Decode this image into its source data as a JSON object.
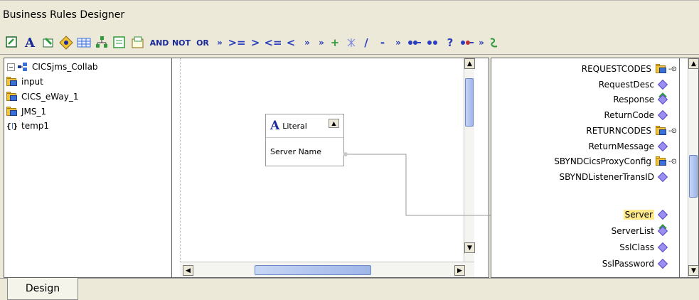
{
  "window": {
    "title": "Business Rules Designer"
  },
  "toolbar": {
    "text_items": [
      "AND",
      "NOT",
      "OR"
    ],
    "operator_items": [
      "»",
      ">=",
      ">",
      "<=",
      "<",
      "»",
      "»",
      "+",
      "/",
      "-",
      "»"
    ]
  },
  "left_tree": {
    "items": [
      {
        "label": "CICSjms_Collab",
        "icon": "collab-icon"
      },
      {
        "label": "input",
        "icon": "folder-icon"
      },
      {
        "label": "CICS_eWay_1",
        "icon": "folder-icon"
      },
      {
        "label": "JMS_1",
        "icon": "folder-icon"
      },
      {
        "label": "temp1",
        "icon": "variable-icon"
      }
    ]
  },
  "canvas": {
    "literal_box": {
      "title": "Literal",
      "row_label": "Server Name"
    }
  },
  "right_tree": {
    "items": [
      {
        "label": "REQUESTCODES",
        "icon": "folder-icon",
        "highlighted": false
      },
      {
        "label": "RequestDesc",
        "icon": "diamond-icon",
        "highlighted": false
      },
      {
        "label": "Response",
        "icon": "diamond-refresh-icon",
        "highlighted": false
      },
      {
        "label": "ReturnCode",
        "icon": "diamond-icon",
        "highlighted": false
      },
      {
        "label": "RETURNCODES",
        "icon": "folder-icon",
        "highlighted": false
      },
      {
        "label": "ReturnMessage",
        "icon": "diamond-icon",
        "highlighted": false
      },
      {
        "label": "SBYNDCicsProxyConfig",
        "icon": "folder-icon",
        "highlighted": false
      },
      {
        "label": "SBYNDListenerTransID",
        "icon": "diamond-icon",
        "highlighted": false
      },
      {
        "label": "Server",
        "icon": "diamond-icon",
        "highlighted": true
      },
      {
        "label": "ServerList",
        "icon": "diamond-refresh-icon",
        "highlighted": false
      },
      {
        "label": "SslClass",
        "icon": "diamond-icon",
        "highlighted": false
      },
      {
        "label": "SslPassword",
        "icon": "diamond-icon",
        "highlighted": false
      }
    ]
  },
  "tabs": {
    "design": "Design"
  },
  "colors": {
    "background": "#ece9d8",
    "highlight": "#ffe98a",
    "toolbar_text": "#1a2a9a"
  }
}
